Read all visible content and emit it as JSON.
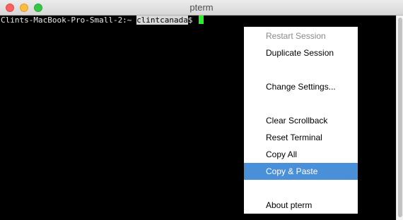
{
  "window": {
    "title": "pterm"
  },
  "terminal": {
    "prompt": "Clints-MacBook-Pro-Small-2:~ ",
    "user": "clintcanada",
    "suffix": "$ "
  },
  "menu": {
    "items": [
      {
        "label": "Restart Session",
        "state": "disabled"
      },
      {
        "label": "Duplicate Session",
        "state": "normal"
      },
      {
        "label": "Change Settings...",
        "state": "normal"
      },
      {
        "label": "Clear Scrollback",
        "state": "normal"
      },
      {
        "label": "Reset Terminal",
        "state": "normal"
      },
      {
        "label": "Copy All",
        "state": "normal"
      },
      {
        "label": "Copy & Paste",
        "state": "highlighted"
      },
      {
        "label": "About pterm",
        "state": "normal"
      }
    ]
  },
  "colors": {
    "highlight": "#4a90d9",
    "cursor": "#29f02a"
  }
}
